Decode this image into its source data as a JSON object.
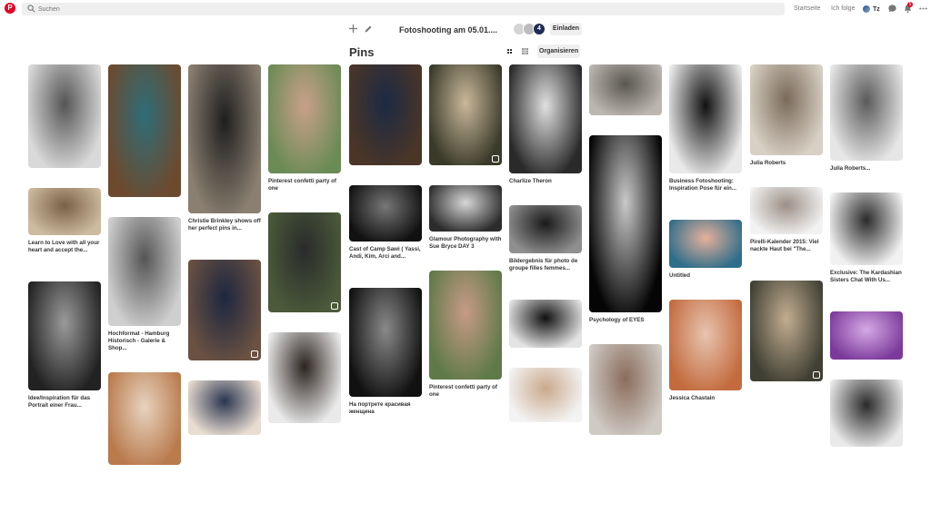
{
  "header": {
    "search_placeholder": "Suchen",
    "nav_home": "Startseite",
    "nav_following": "Ich folge",
    "user_initials": "Tz",
    "notification_count": "5"
  },
  "board": {
    "title": "Fotoshooting am 05.01....",
    "collaborator_count": "4",
    "invite_label": "Einladen",
    "pins_heading": "Pins",
    "organize_label": "Organisieren"
  },
  "colors": {
    "brand": "#e60023",
    "button_bg": "#efefef",
    "collab_badge": "#1e2d55"
  },
  "pins": [
    {
      "title": "",
      "col": 0,
      "h": 114,
      "c1": "#d9d9d9",
      "c2": "#555",
      "expand": false
    },
    {
      "title": "Learn to Love with all your heart and accept the...",
      "col": 0,
      "h": 52,
      "c1": "#cdbb9f",
      "c2": "#7a6048",
      "expand": false
    },
    {
      "title": "Idee/Inspiration für das Portrait einer Frau...",
      "col": 0,
      "h": 120,
      "c1": "#222",
      "c2": "#9a9a9a",
      "expand": false
    },
    {
      "title": "",
      "col": 1,
      "h": 146,
      "c1": "#6d4a2e",
      "c2": "#2d6d78",
      "expand": false
    },
    {
      "title": "Hochformat - Hamburg Historisch - Galerie & Shop...",
      "col": 1,
      "h": 120,
      "c1": "#cfcfcf",
      "c2": "#555",
      "expand": false
    },
    {
      "title": "",
      "col": 1,
      "h": 102,
      "c1": "#b97a4c",
      "c2": "#e7d3bf",
      "expand": false
    },
    {
      "title": "Christie Brinkley shows off her perfect pins in...",
      "col": 2,
      "h": 164,
      "c1": "#8a7f70",
      "c2": "#1f1f1f",
      "expand": false
    },
    {
      "title": "",
      "col": 2,
      "h": 111,
      "c1": "#6a5142",
      "c2": "#1d2740",
      "expand": true
    },
    {
      "title": "",
      "col": 2,
      "h": 60,
      "c1": "#e9dcd0",
      "c2": "#2a3550",
      "expand": false
    },
    {
      "title": "Pinterest confetti party of one",
      "col": 3,
      "h": 120,
      "c1": "#6b8b55",
      "c2": "#c9a08a",
      "expand": false
    },
    {
      "title": "",
      "col": 3,
      "h": 110,
      "c1": "#4a5a3a",
      "c2": "#2b2b2b",
      "expand": true
    },
    {
      "title": "",
      "col": 3,
      "h": 100,
      "c1": "#eaeaea",
      "c2": "#2b2420",
      "expand": false
    },
    {
      "title": "",
      "col": 4,
      "h": 111,
      "c1": "#4b3527",
      "c2": "#1c2a44",
      "expand": false
    },
    {
      "title": "Cast of Camp Sawi ( Yassi, Andi, Kim, Arci and...",
      "col": 4,
      "h": 62,
      "c1": "#111",
      "c2": "#777",
      "expand": false
    },
    {
      "title": "На портрете красивая женщина",
      "col": 4,
      "h": 120,
      "c1": "#111",
      "c2": "#8a8a8a",
      "expand": false
    },
    {
      "title": "",
      "col": 5,
      "h": 111,
      "c1": "#3a3a2a",
      "c2": "#c9b89a",
      "expand": true
    },
    {
      "title": "Glamour Photography with Sue Bryce DAY 3",
      "col": 5,
      "h": 51,
      "c1": "#2c2c2c",
      "c2": "#d7d7d7",
      "expand": false
    },
    {
      "title": "Pinterest confetti party of one",
      "col": 5,
      "h": 120,
      "c1": "#5f7a48",
      "c2": "#c79a86",
      "expand": false
    },
    {
      "title": "Charlize Theron",
      "col": 6,
      "h": 120,
      "c1": "#2a2a2a",
      "c2": "#e0e0e0",
      "expand": false
    },
    {
      "title": "Bildergebnis für photo de groupe filles femmes...",
      "col": 6,
      "h": 53,
      "c1": "#8f8f8f",
      "c2": "#1a1a1a",
      "expand": false
    },
    {
      "title": "",
      "col": 6,
      "h": 53,
      "c1": "#e3e3e3",
      "c2": "#111",
      "expand": false
    },
    {
      "title": "",
      "col": 6,
      "h": 60,
      "c1": "#f3f3f3",
      "c2": "#caa98c",
      "expand": false
    },
    {
      "title": "",
      "col": 7,
      "h": 56,
      "c1": "#bbb7b0",
      "c2": "#5a5650",
      "expand": false
    },
    {
      "title": "Psychology of EYES",
      "col": 7,
      "h": 195,
      "c1": "#050505",
      "c2": "#c9c9c9",
      "expand": false
    },
    {
      "title": "",
      "col": 7,
      "h": 100,
      "c1": "#cfcac4",
      "c2": "#8a6c5c",
      "expand": false
    },
    {
      "title": "Business Fotoshooting: Inspiration Pose für ein...",
      "col": 8,
      "h": 120,
      "c1": "#e9e9e9",
      "c2": "#111",
      "expand": false
    },
    {
      "title": "Untitled",
      "col": 8,
      "h": 53,
      "c1": "#2f6e8a",
      "c2": "#e6b09a",
      "expand": false
    },
    {
      "title": "Jessica Chastain",
      "col": 8,
      "h": 100,
      "c1": "#c36b3e",
      "c2": "#e7c4b0",
      "expand": false
    },
    {
      "title": "Julia Roberts",
      "col": 9,
      "h": 100,
      "c1": "#d8d0c4",
      "c2": "#7a6a5a",
      "expand": false
    },
    {
      "title": "Pirelli-Kalender 2015: Viel nackte Haut bei \"The...",
      "col": 9,
      "h": 52,
      "c1": "#f2f2f2",
      "c2": "#9b8f86",
      "expand": false
    },
    {
      "title": "",
      "col": 9,
      "h": 111,
      "c1": "#3f3f33",
      "c2": "#c2ad90",
      "expand": true
    },
    {
      "title": "Julia Roberts...",
      "col": 10,
      "h": 106,
      "c1": "#e6e6e6",
      "c2": "#5a5a5a",
      "expand": false
    },
    {
      "title": "Exclusive: The Kardashian Sisters Chat With Us...",
      "col": 10,
      "h": 80,
      "c1": "#f1f1f1",
      "c2": "#2b2b2b",
      "expand": false
    },
    {
      "title": "",
      "col": 10,
      "h": 53,
      "c1": "#7b3a9a",
      "c2": "#d6a9e6",
      "expand": false
    },
    {
      "title": "",
      "col": 10,
      "h": 74,
      "c1": "#e9e9e9",
      "c2": "#2a2a2a",
      "expand": false
    }
  ]
}
